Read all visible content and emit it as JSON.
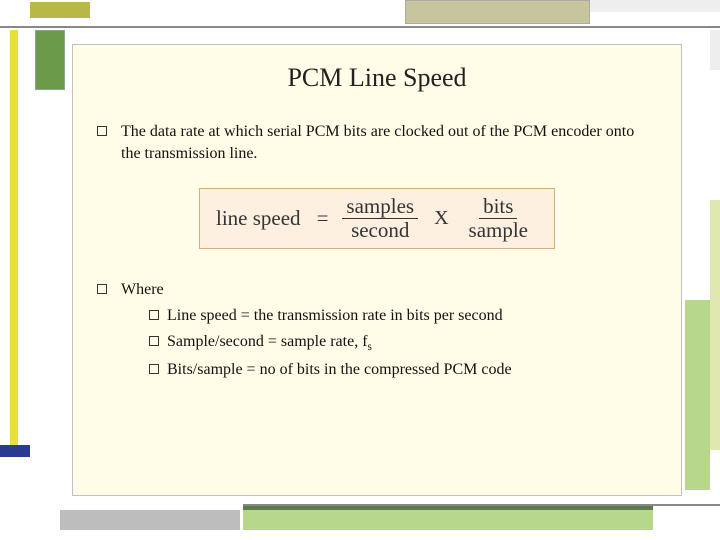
{
  "title": "PCM Line Speed",
  "bullets": {
    "b1": "The data rate at which serial PCM bits are clocked out of the PCM encoder onto the transmission line.",
    "b2": "Where"
  },
  "formula": {
    "lhs": "line speed",
    "eq": "=",
    "frac1_num": "samples",
    "frac1_den": "second",
    "mult": "X",
    "frac2_num": "bits",
    "frac2_den": "sample"
  },
  "subitems": {
    "s1_pre": "Line speed = the transmission rate in bits per second",
    "s2_pre": "Sample/second = sample rate, f",
    "s2_sub": "s",
    "s3_pre": "Bits/sample = no of bits in the compressed PCM code"
  }
}
